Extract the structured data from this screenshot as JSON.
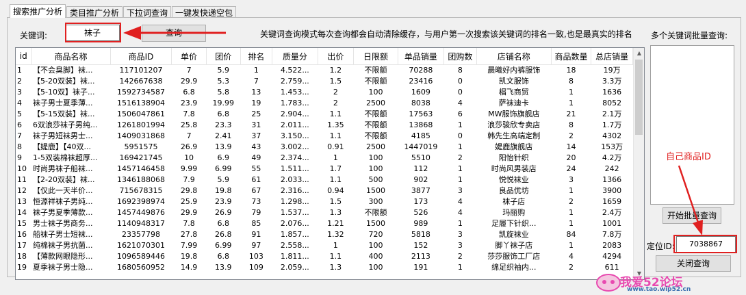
{
  "tabs": [
    "搜索推广分析",
    "类目推广分析",
    "下拉词查询",
    "一键发快递空包"
  ],
  "search": {
    "label": "关键词:",
    "value": "袜子",
    "button": "查询",
    "notice": "关键词查询模式每次查询都会自动清除缓存，与用户第一次搜索该关键词的排名一致,也是最真实的排名"
  },
  "batch": {
    "label": "多个关键词批量查询:",
    "button": "开始批量查询",
    "annotation": "自己商品ID",
    "locate_label": "定位ID:",
    "locate_value": "7038867",
    "partial_button": "关闭查询"
  },
  "table": {
    "columns": [
      "id",
      "商品名称",
      "商品ID",
      "单价",
      "团价",
      "排名",
      "质量分",
      "出价",
      "日限额",
      "单品销量",
      "团购数",
      "店铺名称",
      "商品数量",
      "总店销量"
    ],
    "rows": [
      [
        "1",
        "【不会臭脚】袜...",
        "117101207",
        "7",
        "5.9",
        "1",
        "4.522...",
        "1.2",
        "不限额",
        "70288",
        "8",
        "晨曦好内裤服饰",
        "18",
        "19万"
      ],
      [
        "2",
        "【5-20双装】袜...",
        "142667638",
        "29.9",
        "5.3",
        "7",
        "2.759...",
        "1.5",
        "不限额",
        "23416",
        "0",
        "凯文服饰",
        "8",
        "3.3万"
      ],
      [
        "3",
        "【5-10双】袜子...",
        "1592734587",
        "6.8",
        "5.8",
        "13",
        "1.453...",
        "2",
        "100",
        "1609",
        "0",
        "椙飞商贸",
        "1",
        "1636"
      ],
      [
        "4",
        "袜子男士夏季薄...",
        "1516138904",
        "23.9",
        "19.99",
        "19",
        "1.783...",
        "2",
        "2500",
        "8038",
        "4",
        "萨袜迪卡",
        "1",
        "8052"
      ],
      [
        "5",
        "【5-15双装】袜...",
        "1506047861",
        "7.8",
        "6.8",
        "25",
        "2.904...",
        "1.1",
        "不限额",
        "17563",
        "6",
        "MW服饰旗舰店",
        "21",
        "2.1万"
      ],
      [
        "6",
        "6双浪莎袜子男纯...",
        "1261801994",
        "25.8",
        "23.3",
        "31",
        "2.011...",
        "1.35",
        "不限额",
        "13868",
        "1",
        "浪莎骏欣专卖店",
        "8",
        "1.7万"
      ],
      [
        "7",
        "袜子男短袜男士...",
        "1409031868",
        "7",
        "2.41",
        "37",
        "3.150...",
        "1.1",
        "不限额",
        "4185",
        "0",
        "韩先生高端定制",
        "2",
        "4302"
      ],
      [
        "8",
        "【媞鹿】【40双...",
        "5951575",
        "26.9",
        "13.9",
        "43",
        "3.002...",
        "0.91",
        "2500",
        "1447019",
        "1",
        "媞鹿旗舰店",
        "14",
        "153万"
      ],
      [
        "9",
        "1-5双装棉袜超厚...",
        "169421745",
        "10",
        "6.9",
        "49",
        "2.374...",
        "1",
        "100",
        "5510",
        "2",
        "阳怡针织",
        "20",
        "4.2万"
      ],
      [
        "10",
        "时尚男袜子船袜...",
        "1457146458",
        "9.99",
        "6.99",
        "55",
        "1.511...",
        "1.7",
        "100",
        "112",
        "1",
        "时尚风男装店",
        "24",
        "242"
      ],
      [
        "11",
        "【2-20双装】袜...",
        "1346188068",
        "7.9",
        "5.9",
        "61",
        "2.033...",
        "1.1",
        "500",
        "902",
        "1",
        "悦悦袜业",
        "3",
        "1366"
      ],
      [
        "12",
        "【仅此一天半价...",
        "715678315",
        "29.8",
        "19.8",
        "67",
        "2.316...",
        "0.94",
        "1500",
        "3877",
        "3",
        "良品优坊",
        "1",
        "3900"
      ],
      [
        "13",
        "恒源祥袜子男纯...",
        "1692398974",
        "25.9",
        "23.9",
        "73",
        "1.298...",
        "1.5",
        "300",
        "173",
        "4",
        "袜子店",
        "2",
        "1659"
      ],
      [
        "14",
        "袜子男夏季薄款...",
        "1457449876",
        "29.9",
        "26.9",
        "79",
        "1.537...",
        "1.3",
        "不限额",
        "526",
        "4",
        "玛丽购",
        "1",
        "2.4万"
      ],
      [
        "15",
        "男士袜子男商务...",
        "1140948317",
        "7.8",
        "6.8",
        "85",
        "2.076...",
        "1.21",
        "1500",
        "989",
        "1",
        "足履下针织...",
        "1",
        "1001"
      ],
      [
        "16",
        "船袜子男士短袜...",
        "23357798",
        "27.8",
        "26.8",
        "91",
        "1.857...",
        "1.32",
        "720",
        "5818",
        "3",
        "凯旋袜业",
        "84",
        "7.8万"
      ],
      [
        "17",
        "纯棉袜子男抗菌...",
        "1621070301",
        "7.99",
        "6.99",
        "97",
        "2.558...",
        "1",
        "100",
        "152",
        "3",
        "脚丫袜子店",
        "1",
        "2083"
      ],
      [
        "18",
        "【薄款网眼隐形...",
        "1096589446",
        "19.8",
        "6.8",
        "103",
        "1.811...",
        "1.1",
        "400",
        "2113",
        "2",
        "莎莎服饰工厂店",
        "4",
        "4294"
      ],
      [
        "19",
        "夏季袜子男士隐...",
        "1680560952",
        "14.9",
        "13.9",
        "109",
        "2.059...",
        "1.3",
        "100",
        "191",
        "1",
        "绵足织袖内...",
        "2",
        "611"
      ]
    ]
  },
  "watermark": {
    "text": "我爱52论坛",
    "url": "www.tao.wip52.cn"
  }
}
